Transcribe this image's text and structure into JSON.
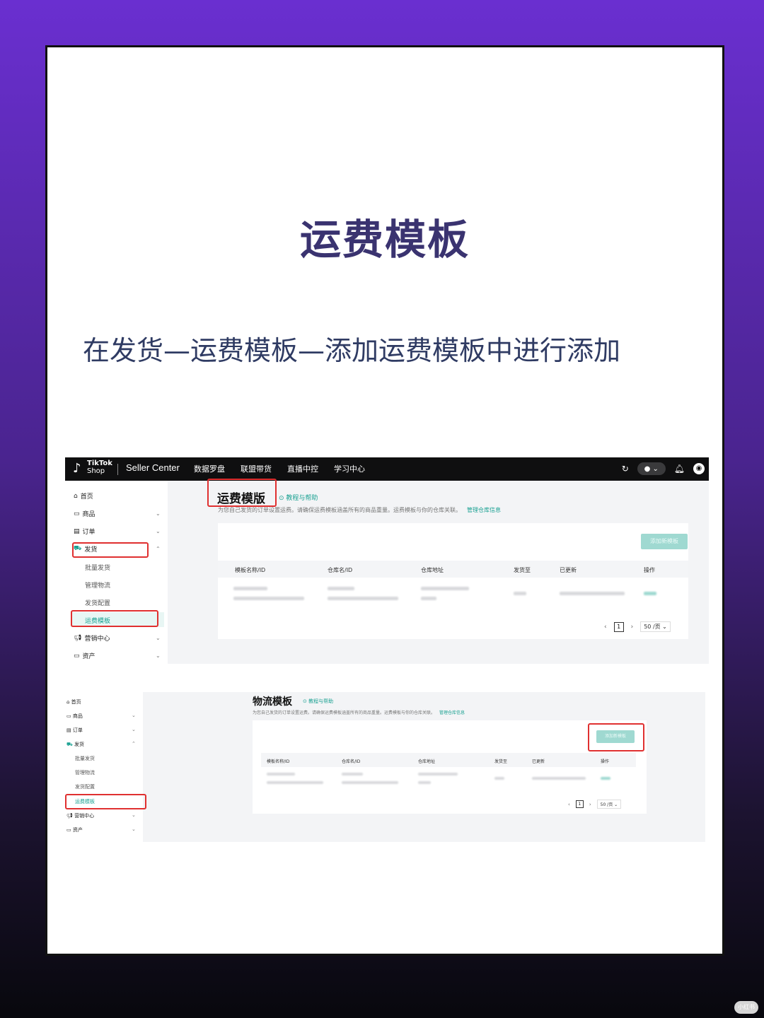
{
  "headline": "运费模板",
  "subtitle": "在发货—运费模板—添加运费模板中进行添加",
  "shot1": {
    "brand": {
      "logo_line1": "TikTok",
      "logo_line2": "Shop",
      "product": "Seller Center"
    },
    "topnav": [
      "数据罗盘",
      "联盟带货",
      "直播中控",
      "学习中心"
    ],
    "sidebar": {
      "items": [
        {
          "icon": "home-icon",
          "label": "首页"
        },
        {
          "icon": "product-icon",
          "label": "商品"
        },
        {
          "icon": "order-icon",
          "label": "订单"
        },
        {
          "icon": "shipping-icon",
          "label": "发货"
        }
      ],
      "subitems": [
        "批量发货",
        "管理物流",
        "发货配置",
        "运费模板"
      ],
      "items_after": [
        {
          "icon": "megaphone-icon",
          "label": "营销中心"
        },
        {
          "icon": "asset-icon",
          "label": "资产"
        }
      ]
    },
    "page": {
      "title": "运费模版",
      "help_link": "教程与帮助",
      "description": "为您自己发货的订单设置运费。请确保运费模板涵盖所有的商品重量。运费模板与你的仓库关联。",
      "manage_link": "管理仓库信息",
      "add_button": "添加新模板",
      "table_headers": [
        "模板名称/ID",
        "仓库名/ID",
        "仓库地址",
        "发货至",
        "已更新",
        "操作"
      ],
      "pager": {
        "current": "1",
        "page_size": "50 /页"
      }
    }
  },
  "shot2": {
    "sidebar": {
      "items": [
        {
          "icon": "home-icon",
          "label": "首页"
        },
        {
          "icon": "product-icon",
          "label": "商品"
        },
        {
          "icon": "order-icon",
          "label": "订单"
        },
        {
          "icon": "shipping-icon",
          "label": "发货"
        }
      ],
      "subitems": [
        "批量发货",
        "管理物流",
        "发货配置",
        "运费模板"
      ],
      "items_after": [
        {
          "icon": "megaphone-icon",
          "label": "营销中心"
        },
        {
          "icon": "asset-icon",
          "label": "资产"
        }
      ]
    },
    "page": {
      "title": "物流模板",
      "help_link": "教程与帮助",
      "description": "为您自己发货的订单设置运费。请确保运费模板涵盖所有的商品重量。运费模板与你的仓库关联。",
      "manage_link": "管理仓库信息",
      "add_button": "添加新模板",
      "table_headers": [
        "模板名称/ID",
        "仓库名/ID",
        "仓库地址",
        "发货至",
        "已更新",
        "操作"
      ],
      "pager": {
        "current": "1",
        "page_size": "50 /页"
      }
    }
  },
  "watermark": "小红书",
  "colors": {
    "accent": "#1aa192",
    "highlight_box": "#e03030",
    "headline": "#3a3370"
  }
}
